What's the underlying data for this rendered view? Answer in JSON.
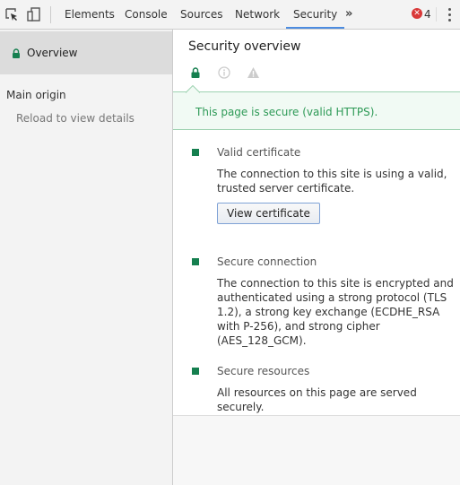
{
  "toolbar": {
    "tabs": [
      {
        "label": "Elements"
      },
      {
        "label": "Console"
      },
      {
        "label": "Sources"
      },
      {
        "label": "Network"
      },
      {
        "label": "Security",
        "active": true
      }
    ],
    "more_label": "»",
    "error_count": "4",
    "accent_color": "#4d8ce0",
    "error_color": "#d93838"
  },
  "sidebar": {
    "overview_label": "Overview",
    "main_origin_label": "Main origin",
    "reload_label": "Reload to view details"
  },
  "main": {
    "title": "Security overview",
    "summary_icons": [
      "lock-icon",
      "info-icon",
      "warning-icon"
    ],
    "banner_text": "This page is secure (valid HTTPS).",
    "secure_color": "#157f4f",
    "sections": [
      {
        "title": "Valid certificate",
        "description": "The connection to this site is using a valid, trusted server certificate.",
        "button_label": "View certificate"
      },
      {
        "title": "Secure connection",
        "description": "The connection to this site is encrypted and authenticated using a strong protocol (TLS 1.2), a strong key exchange (ECDHE_RSA with P-256), and strong cipher (AES_128_GCM)."
      },
      {
        "title": "Secure resources",
        "description": "All resources on this page are served securely."
      }
    ]
  }
}
